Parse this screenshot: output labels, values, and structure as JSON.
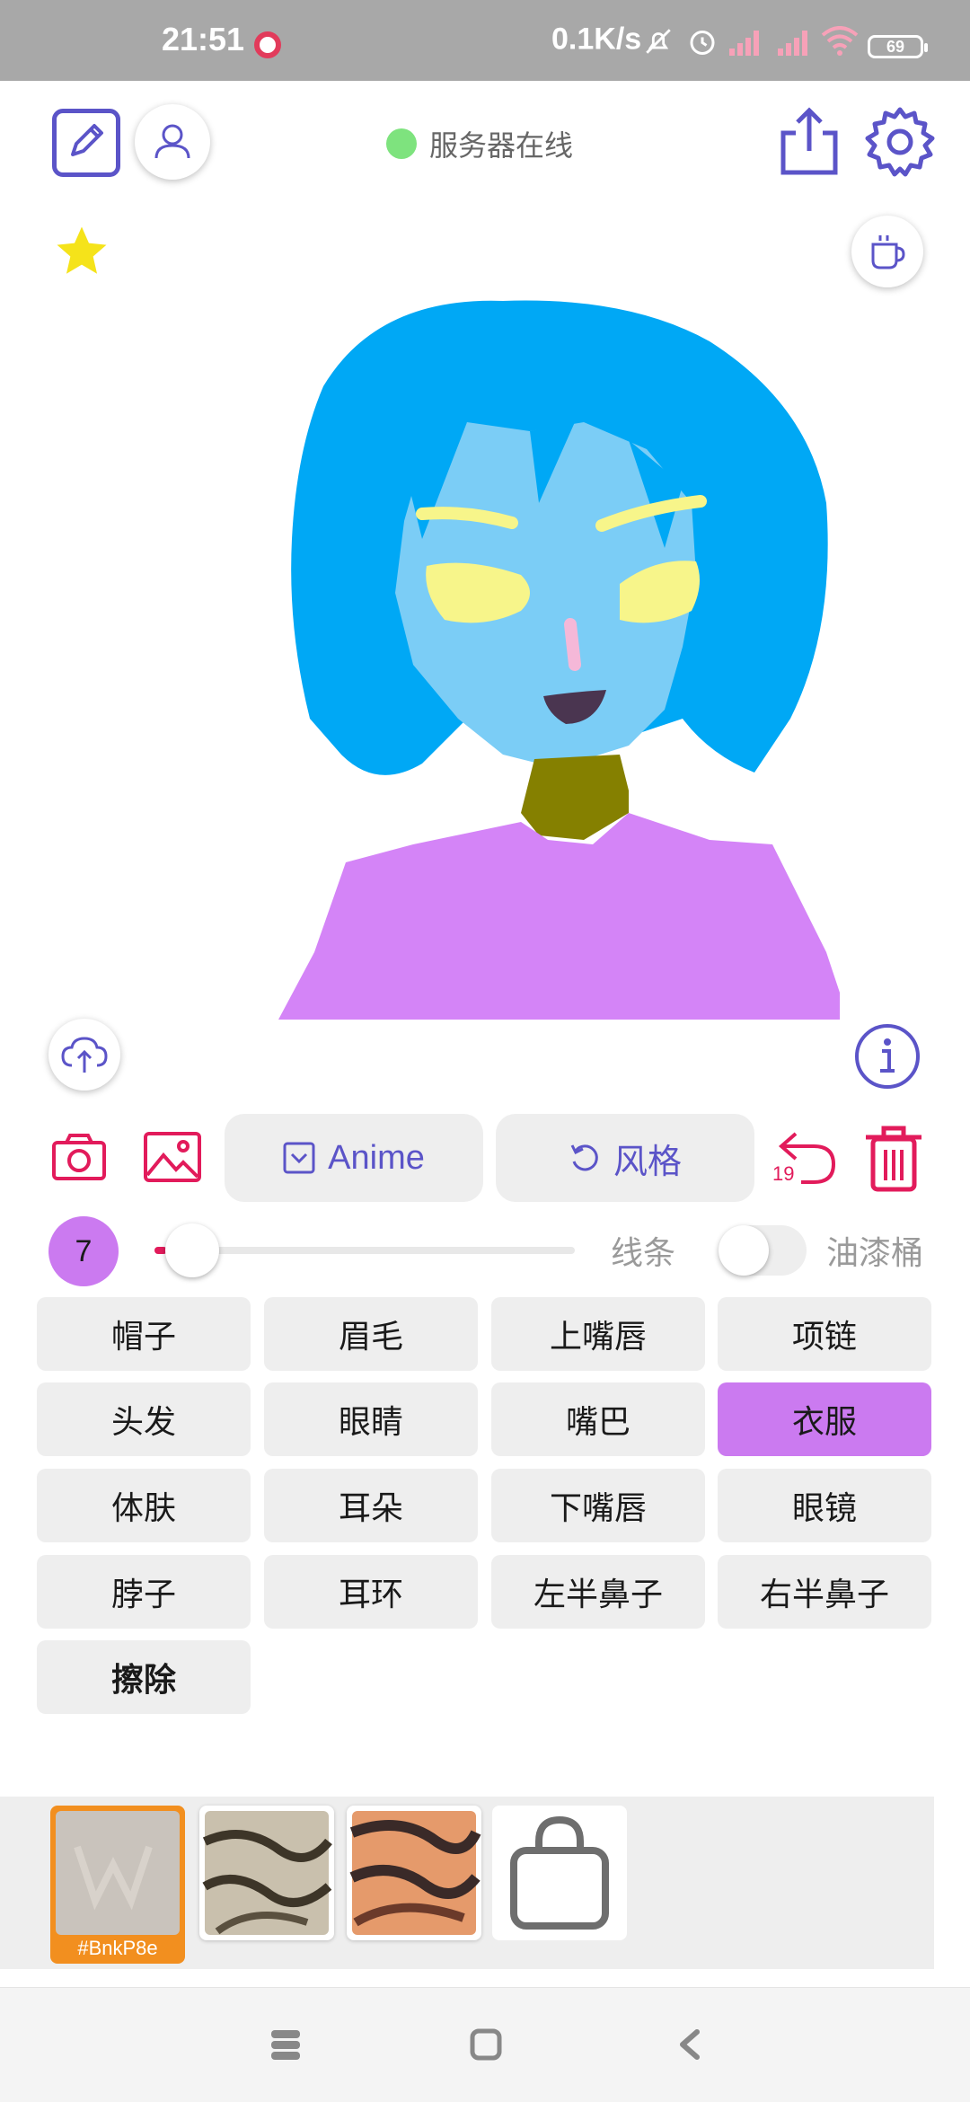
{
  "status_bar": {
    "time": "21:51",
    "network_speed": "0.1K/s",
    "battery": "69",
    "icons": [
      "recording-icon",
      "mute-icon",
      "alarm-icon",
      "signal-icon",
      "signal-icon",
      "wifi-icon",
      "battery-icon"
    ]
  },
  "header": {
    "server_status": "服务器在线",
    "server_status_color": "#7ee37e",
    "accent_color": "#5b54c8"
  },
  "toolbar": {
    "anime_label": "Anime",
    "style_label": "风格",
    "undo_count": "19",
    "danger_color": "#e21b5b"
  },
  "brush": {
    "size": "7",
    "slider_level": 0.03,
    "line_label": "线条",
    "bucket_label": "油漆桶",
    "bucket_enabled": false
  },
  "parts": [
    {
      "label": "帽子",
      "active": false
    },
    {
      "label": "眉毛",
      "active": false
    },
    {
      "label": "上嘴唇",
      "active": false
    },
    {
      "label": "项链",
      "active": false
    },
    {
      "label": "头发",
      "active": false
    },
    {
      "label": "眼睛",
      "active": false
    },
    {
      "label": "嘴巴",
      "active": false
    },
    {
      "label": "衣服",
      "active": true
    },
    {
      "label": "体肤",
      "active": false
    },
    {
      "label": "耳朵",
      "active": false
    },
    {
      "label": "下嘴唇",
      "active": false
    },
    {
      "label": "眼镜",
      "active": false
    },
    {
      "label": "脖子",
      "active": false
    },
    {
      "label": "耳环",
      "active": false
    },
    {
      "label": "左半鼻子",
      "active": false
    },
    {
      "label": "右半鼻子",
      "active": false
    },
    {
      "label": "擦除",
      "active": false
    }
  ],
  "materials": {
    "selected_tag": "#BnkP8e",
    "selected_color": "#f28f1f"
  },
  "drawing_colors": {
    "hair": "#00a8f5",
    "skin": "#7bcdf6",
    "eyes": "#f7f58a",
    "nose": "#f5b8d8",
    "mouth": "#4a3550",
    "neck": "#858000",
    "clothes": "#d484f7"
  }
}
